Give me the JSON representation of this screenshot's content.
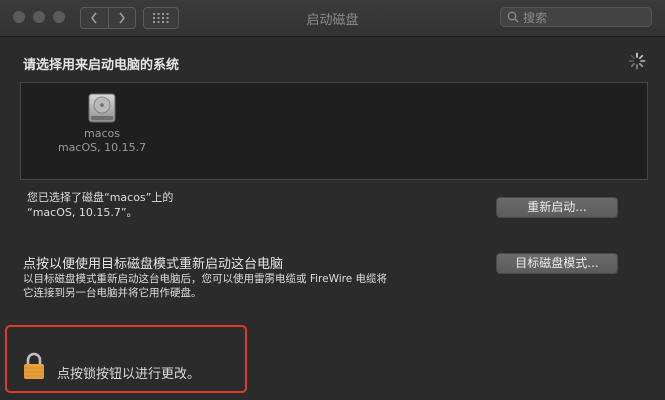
{
  "window": {
    "title": "启动磁盘",
    "search_placeholder": "搜索",
    "traffic_lights": [
      "close",
      "minimize",
      "zoom"
    ],
    "nav": {
      "back": "back-chevron-icon",
      "forward": "forward-chevron-icon",
      "show_all": "grid-icon"
    }
  },
  "main": {
    "heading": "请选择用来启动电脑的系统",
    "disks": [
      {
        "name": "macos",
        "os": "macOS, 10.15.7",
        "icon": "hard-drive-icon"
      }
    ],
    "selected_line1": "您已选择了磁盘“macos”上的",
    "selected_line2": "“macOS, 10.15.7”。",
    "restart_button": "重新启动...",
    "target_title": "点按以便使用目标磁盘模式重新启动这台电脑",
    "target_desc_line1": "以目标磁盘模式重新启动这台电脑后，您可以使用雷雳电缆或 FireWire 电缆将",
    "target_desc_line2": "它连接到另一台电脑并将它用作硬盘。",
    "target_button": "目标磁盘模式..."
  },
  "lock": {
    "text": "点按锁按钮以进行更改。",
    "icon": "lock-icon"
  },
  "colors": {
    "highlight_border": "#e03a2a",
    "lock_gold": "#e8a13a",
    "background": "#2b2b2b",
    "panel": "#1f1f1f"
  }
}
